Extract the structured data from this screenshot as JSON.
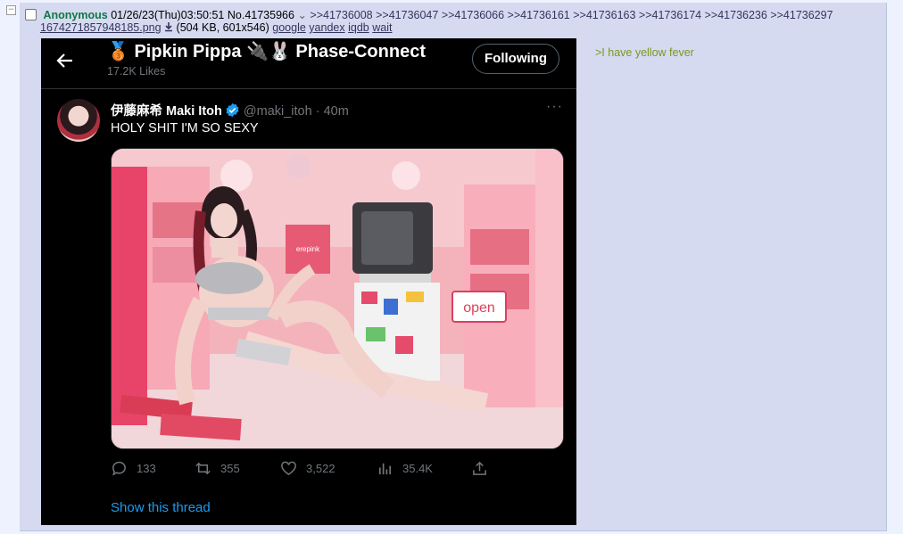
{
  "post": {
    "collapse": "−",
    "name": "Anonymous",
    "datetime": "01/26/23(Thu)03:50:51",
    "number": "No.41735966",
    "menu_arrow": "⌄",
    "backlinks": [
      ">>41736008",
      ">>41736047",
      ">>41736066",
      ">>41736161",
      ">>41736163",
      ">>41736174",
      ">>41736236",
      ">>41736297"
    ],
    "file": {
      "name": "1674271857948185.png",
      "details": "(504 KB, 601x546)",
      "search_links": [
        "google",
        "yandex",
        "iqdb",
        "wait"
      ]
    },
    "comment": ">I have yellow fever"
  },
  "tweet": {
    "header_title": "🥉 Pipkin Pippa 🔌🐰 Phase-Connect",
    "header_likes": "17.2K Likes",
    "follow_label": "Following",
    "author_name": "伊藤麻希 Maki Itoh",
    "handle_time": "@maki_itoh · 40m",
    "more": "···",
    "text": "HOLY SHIT I'M SO SEXY",
    "photo_sign": "open",
    "photo_bag_label": "erepink",
    "stats": {
      "replies": "133",
      "retweets": "355",
      "likes": "3,522",
      "views": "35.4K"
    },
    "show_thread": "Show this thread"
  },
  "colors": {
    "name_green": "#117743",
    "greentext": "#789922",
    "post_bg": "#d6daf0",
    "link": "#34345c",
    "twitter_blue": "#1d9bf0"
  }
}
